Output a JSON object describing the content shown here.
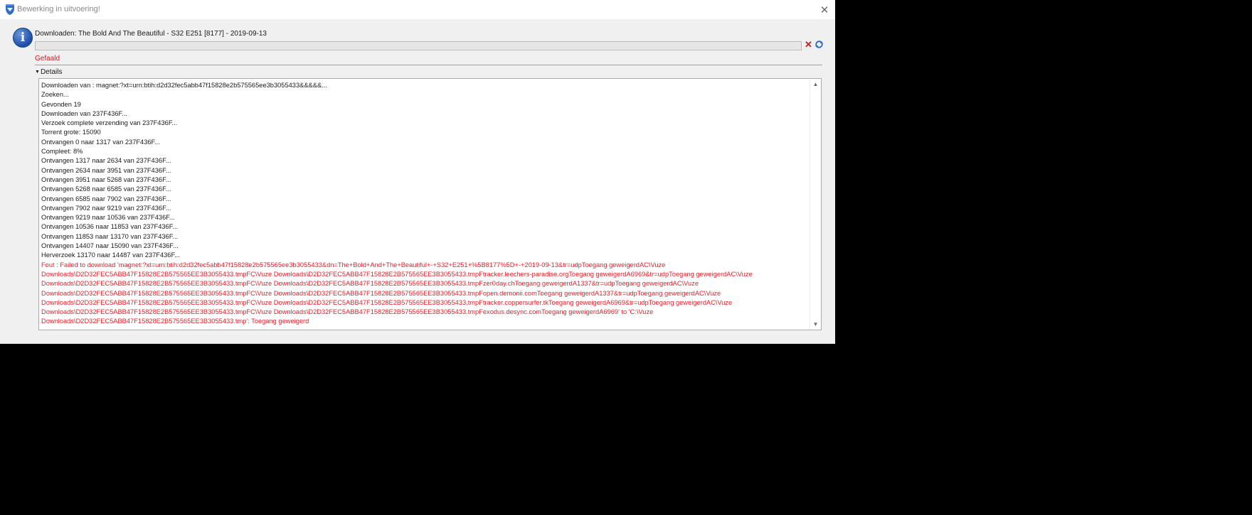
{
  "window": {
    "title": "Bewerking in uitvoering!"
  },
  "header": {
    "label": "Downloaden: The Bold And The Beautiful - S32 E251 [8177] - 2019-09-13",
    "progress_fraction": 0.0
  },
  "status": {
    "text": "Gefaald"
  },
  "details": {
    "toggle_label": "Details",
    "log_lines": [
      "Downloaden van : magnet:?xt=urn:btih:d2d32fec5abb47f15828e2b575565ee3b3055433&&&&&...",
      "Zoeken...",
      "Gevonden 19",
      "Downloaden van 237F436F...",
      "Verzoek complete verzending van 237F436F...",
      "Torrent grote: 15090",
      "Ontvangen 0 naar 1317 van 237F436F...",
      "Compleet: 8%",
      "Ontvangen 1317 naar 2634 van 237F436F...",
      "Ontvangen 2634 naar 3951 van 237F436F...",
      "Ontvangen 3951 naar 5268 van 237F436F...",
      "Ontvangen 5268 naar 6585 van 237F436F...",
      "Ontvangen 6585 naar 7902 van 237F436F...",
      "Ontvangen 7902 naar 9219 van 237F436F...",
      "Ontvangen 9219 naar 10536 van 237F436F...",
      "Ontvangen 10536 naar 11853 van 237F436F...",
      "Ontvangen 11853 naar 13170 van 237F436F...",
      "Ontvangen 14407 naar 15090 van 237F436F...",
      "Herverzoek 13170 naar 14487 van 237F436F..."
    ],
    "error_lines": [
      "Fout : Failed to download 'magnet:?xt=urn:btih:d2d32fec5abb47f15828e2b575565ee3b3055433&dn=The+Bold+And+The+Beautiful+-+S32+E251+%5B8177%5D+-+2019-09-13&tr=udpToegang geweigerdAC\\Vuze",
      "Downloads\\D2D32FEC5ABB47F15828E2B575565EE3B3055433.tmpFC\\Vuze Downloads\\D2D32FEC5ABB47F15828E2B575565EE3B3055433.tmpFtracker.leechers-paradise.orgToegang geweigerdA6969&tr=udpToegang geweigerdAC\\Vuze",
      "Downloads\\D2D32FEC5ABB47F15828E2B575565EE3B3055433.tmpFC\\Vuze Downloads\\D2D32FEC5ABB47F15828E2B575565EE3B3055433.tmpFzer0day.chToegang geweigerdA1337&tr=udpToegang geweigerdAC\\Vuze",
      "Downloads\\D2D32FEC5ABB47F15828E2B575565EE3B3055433.tmpFC\\Vuze Downloads\\D2D32FEC5ABB47F15828E2B575565EE3B3055433.tmpFopen.demonii.comToegang geweigerdA1337&tr=udpToegang geweigerdAC\\Vuze",
      "Downloads\\D2D32FEC5ABB47F15828E2B575565EE3B3055433.tmpFC\\Vuze Downloads\\D2D32FEC5ABB47F15828E2B575565EE3B3055433.tmpFtracker.coppersurfer.tkToegang geweigerdA6969&tr=udpToegang geweigerdAC\\Vuze",
      "Downloads\\D2D32FEC5ABB47F15828E2B575565EE3B3055433.tmpFC\\Vuze Downloads\\D2D32FEC5ABB47F15828E2B575565EE3B3055433.tmpFexodus.desync.comToegang geweigerdA6969' to 'C:\\Vuze",
      "Downloads\\D2D32FEC5ABB47F15828E2B575565EE3B3055433.tmp': Toegang geweigerd"
    ]
  },
  "colors": {
    "error": "#e8202a",
    "dialog_bg": "#f0f0f0",
    "desktop_bg": "#000000"
  },
  "icons": {
    "app": "vuze-frog-icon",
    "info": "info-icon",
    "cancel": "cancel-x-icon",
    "retry": "retry-icon",
    "close": "close-icon"
  }
}
